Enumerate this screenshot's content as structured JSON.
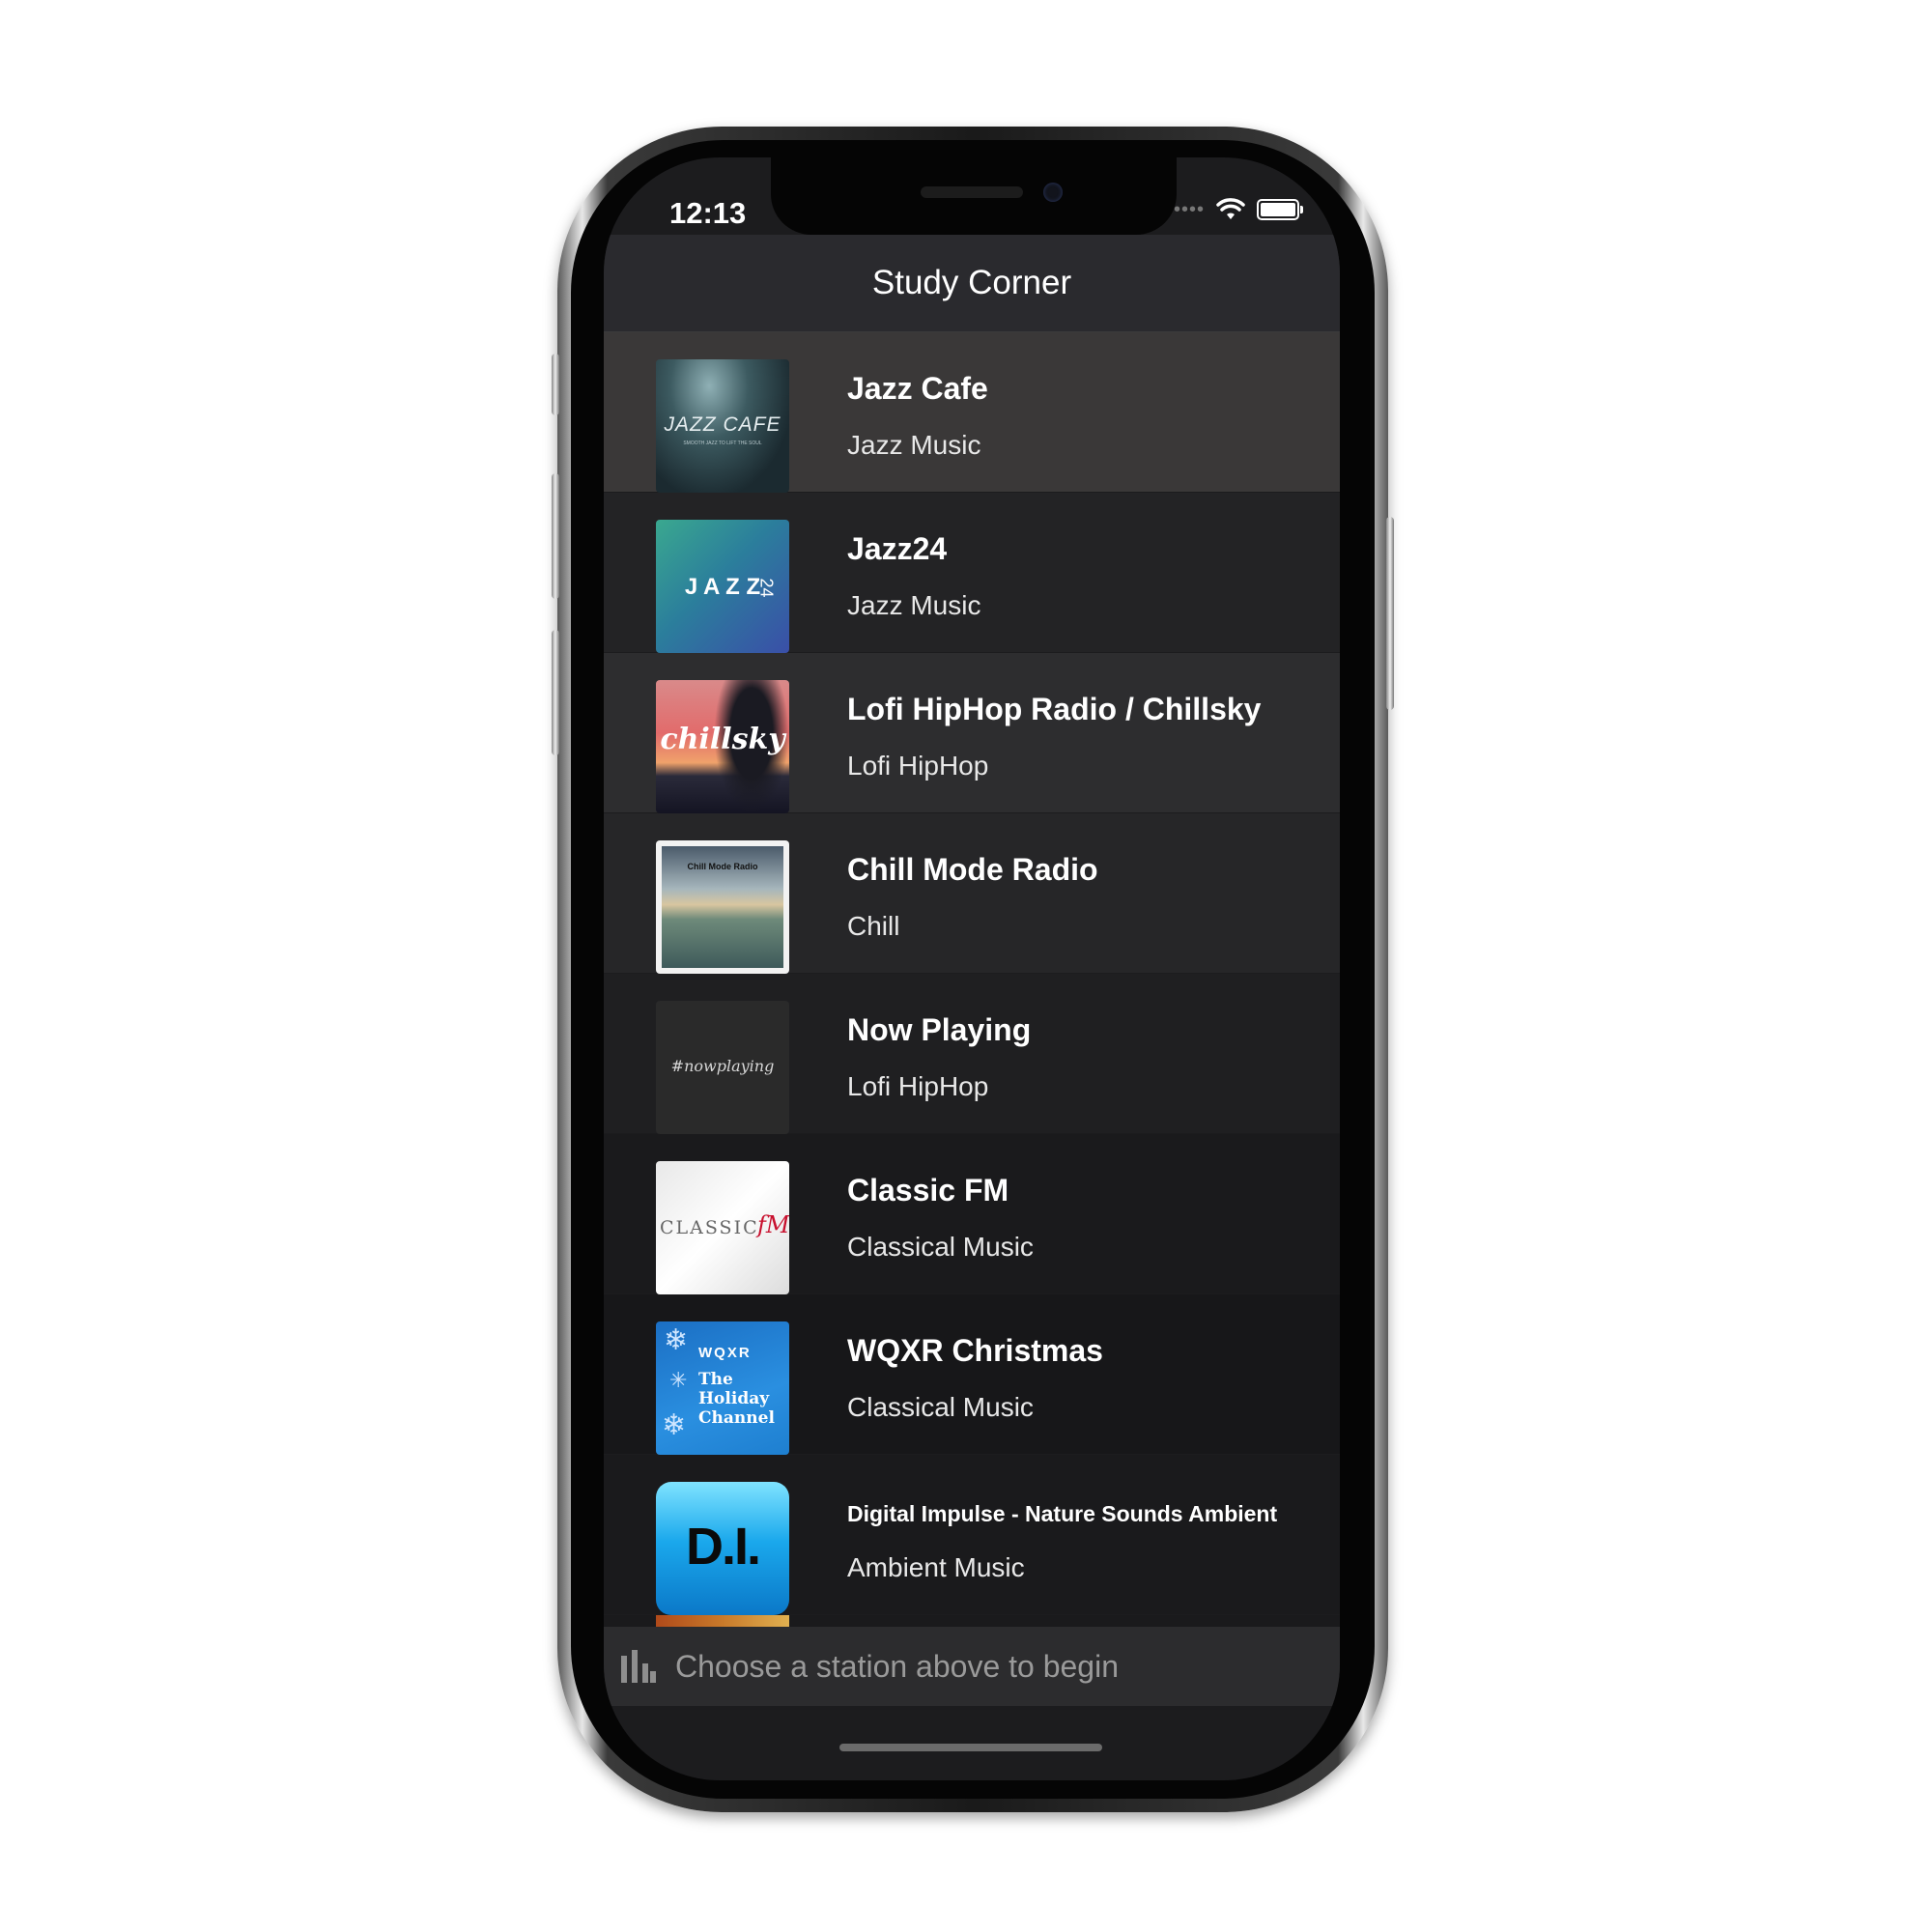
{
  "status": {
    "time": "12:13",
    "signal_dots": "••••"
  },
  "header": {
    "title": "Study Corner"
  },
  "stations": [
    {
      "name": "Jazz Cafe",
      "genre": "Jazz Music",
      "art": "JAZZ CAFE",
      "art_sub": "SMOOTH JAZZ TO LIFT THE SOUL"
    },
    {
      "name": "Jazz24",
      "genre": "Jazz Music",
      "art": "J A Z Z",
      "art_sub": "24"
    },
    {
      "name": "Lofi HipHop Radio / Chillsky",
      "genre": "Lofi HipHop",
      "art": "chillsky"
    },
    {
      "name": "Chill Mode Radio",
      "genre": "Chill",
      "art": "Chill Mode Radio"
    },
    {
      "name": "Now Playing",
      "genre": "Lofi HipHop",
      "art": "#nowplaying"
    },
    {
      "name": "Classic FM",
      "genre": "Classical Music",
      "art": "CLASSIC",
      "art_sub": "fM"
    },
    {
      "name": "WQXR Christmas",
      "genre": "Classical Music",
      "art": "WQXR",
      "art_sub": "The Holiday Channel"
    },
    {
      "name": "Digital Impulse - Nature Sounds Ambient",
      "genre": "Ambient Music",
      "art": "D.I."
    }
  ],
  "player": {
    "placeholder": "Choose a station above to begin"
  },
  "colors": {
    "background": "#1c1c1e",
    "navbar": "#2a2a2e",
    "selected_row": "#3a3a3c",
    "footer": "#2c2c2e"
  }
}
